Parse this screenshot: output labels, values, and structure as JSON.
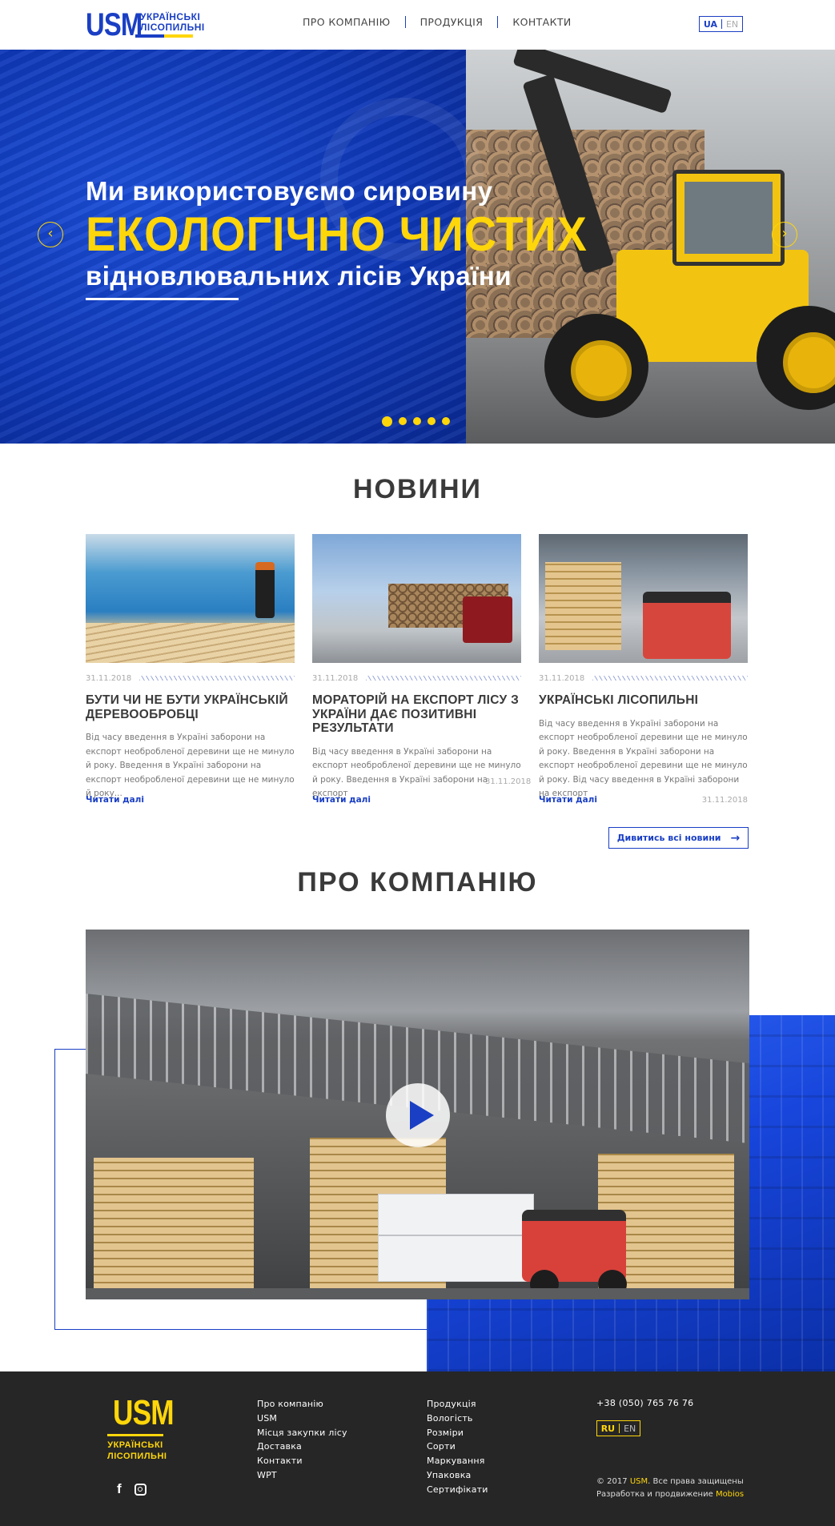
{
  "header": {
    "logo_mark": "USM",
    "logo_line1": "УКРАЇНСЬКІ",
    "logo_line2": "ЛІСОПИЛЬНІ",
    "nav": [
      "ПРО КОМПАНІЮ",
      "ПРОДУКЦІЯ",
      "КОНТАКТИ"
    ],
    "lang_active": "UA",
    "lang_other": "EN"
  },
  "hero": {
    "line1": "Ми використовуємо сировину",
    "line2": "ЕКОЛОГІЧНО ЧИСТИХ",
    "line3": "відновлювальних лісів України",
    "prev_icon": "‹",
    "next_icon": "›",
    "slides_total": 5,
    "slide_active": 1
  },
  "news": {
    "title": "НОВИНИ",
    "cards": [
      {
        "date": "31.11.2018",
        "title": "БУТИ ЧИ НЕ БУТИ УКРАЇНСЬКІЙ ДЕРЕВООБРОБЦІ",
        "text": "Від часу введення в Україні заборони на експорт необробленої деревини ще не минуло й року. Введення в Україні заборони на експорт необробленої деревини ще не минуло й року...",
        "more": "Читати далі",
        "bottom_date": ""
      },
      {
        "date": "31.11.2018",
        "title": "МОРАТОРІЙ НА ЕКСПОРТ ЛІСУ З УКРАЇНИ ДАЄ ПОЗИТИВНІ РЕЗУЛЬТАТИ",
        "text": "Від часу введення в Україні заборони на експорт необробленої деревини ще не минуло й року. Введення в Україні заборони на експорт",
        "inline_date": "31.11.2018",
        "more": "Читати далі",
        "bottom_date": ""
      },
      {
        "date": "31.11.2018",
        "title": "УКРАЇНСЬКІ ЛІСОПИЛЬНІ",
        "text": "Від часу введення в Україні заборони на експорт необробленої деревини ще не минуло й року. Введення в Україні заборони на експорт необробленої деревини ще не минуло й року. Від часу введення в Україні заборони на експорт",
        "more": "Читати далі",
        "bottom_date": "31.11.2018"
      }
    ],
    "all_news": "Дивитись всі новини",
    "all_news_icon": "→"
  },
  "about": {
    "title": "ПРО КОМПАНІЮ",
    "video_icon": "play-icon"
  },
  "footer": {
    "logo_mark": "USM",
    "logo_line1": "УКРАЇНСЬКІ",
    "logo_line2": "ЛІСОПИЛЬНІ",
    "social_fb": "f",
    "col1": [
      "Про компанію",
      "USM",
      "Місця закупки лісу",
      "Доставка",
      "Контакти",
      "WPT"
    ],
    "col2": [
      "Продукція",
      "Вологість",
      "Розміри",
      "Сорти",
      "Маркування",
      "Упаковка",
      "Сертифікати"
    ],
    "phone": "+38 (050) 765 76 76",
    "lang_active": "RU",
    "lang_other": "EN",
    "copy_prefix": "© 2017 ",
    "copy_brand": "USM",
    "copy_suffix": ". Все права защищены",
    "dev_prefix": "Разработка и продвижение ",
    "dev_brand": "Mobios"
  },
  "colors": {
    "brand_blue": "#1a3fc4",
    "accent_yellow": "#ffd60a",
    "footer_bg": "#262626"
  }
}
